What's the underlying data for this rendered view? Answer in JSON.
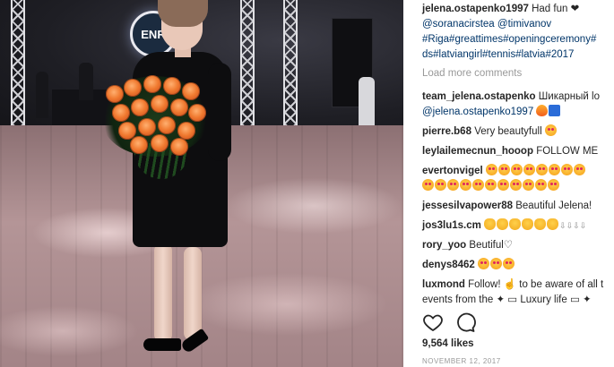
{
  "post": {
    "caption_user": "jelena.ostapenko1997",
    "caption_lines": [
      "Had fun ❤",
      "@soranacirstea @timivanov",
      "#Riga#greattimes#openingceremony#",
      "ds#latviangirl#tennis#latvia#2017"
    ],
    "load_more": "Load more comments",
    "likes": "9,564 likes",
    "date": "NOVEMBER 12, 2017"
  },
  "photo": {
    "sign_text": "ENR",
    "rose_color": "#f07a30",
    "dress_color": "#0d0d0f"
  },
  "comments": [
    {
      "user": "team_jelena.ostapenko",
      "text": "Шикарный lo",
      "line2": "@jelena.ostapenko1997",
      "emojis2": [
        "fire",
        "blue"
      ]
    },
    {
      "user": "pierre.b68",
      "text": "Very beautyfull",
      "emojis": [
        "heart"
      ]
    },
    {
      "user": "leylailemecnun_hooop",
      "text": "FOLLOW ME"
    },
    {
      "user": "evertonvigel",
      "text": "",
      "emojis": [
        "heart",
        "heart",
        "heart",
        "heart",
        "heart",
        "heart",
        "heart",
        "heart"
      ],
      "emojis2": [
        "heart",
        "heart",
        "heart",
        "heart",
        "heart",
        "heart",
        "heart",
        "heart",
        "heart",
        "heart",
        "heart"
      ]
    },
    {
      "user": "jessesilvapower88",
      "text": "Beautiful Jelena!"
    },
    {
      "user": "jos3lu1s.cm",
      "text": "",
      "emojis": [
        "hand",
        "hand",
        "hand",
        "hand",
        "hand",
        "hand"
      ],
      "trail": "⇩⇩⇩⇩"
    },
    {
      "user": "rory_yoo",
      "text": "Beutiful♡"
    },
    {
      "user": "denys8462",
      "text": "",
      "emojis": [
        "heart",
        "heart",
        "heart"
      ]
    },
    {
      "user": "luxmond",
      "text": "Follow! ☝ to be aware of all t",
      "line2": "events from the ✦ ▭ Luxury life ▭ ✦"
    }
  ]
}
